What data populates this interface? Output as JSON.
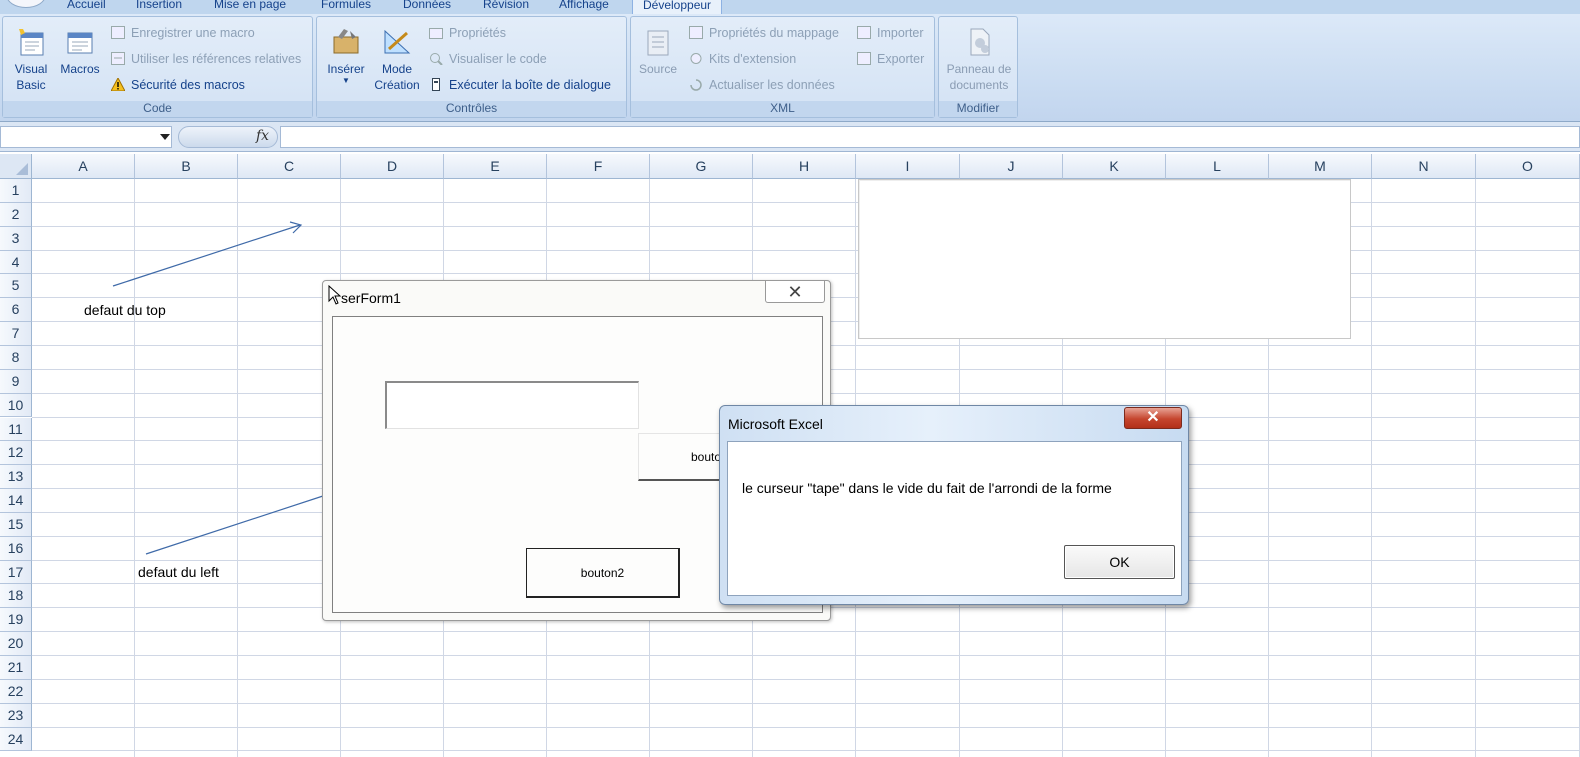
{
  "ribbon": {
    "tabs": [
      "Accueil",
      "Insertion",
      "Mise en page",
      "Formules",
      "Données",
      "Révision",
      "Affichage",
      "Développeur"
    ],
    "groups": {
      "code": {
        "label": "Code",
        "visual_basic": [
          "Visual",
          "Basic"
        ],
        "macros": "Macros",
        "record_macro": "Enregistrer une macro",
        "relative_refs": "Utiliser les références relatives",
        "macro_security": "Sécurité des macros"
      },
      "controls": {
        "label": "Contrôles",
        "insert": "Insérer",
        "design_mode": [
          "Mode",
          "Création"
        ],
        "properties": "Propriétés",
        "view_code": "Visualiser le code",
        "run_dialog": "Exécuter la boîte de dialogue"
      },
      "xml": {
        "label": "XML",
        "source": "Source",
        "map_properties": "Propriétés du mappage",
        "expansion_packs": "Kits d'extension",
        "refresh_data": "Actualiser les données",
        "import": "Importer",
        "export": "Exporter"
      },
      "modify": {
        "label": "Modifier",
        "document_panel": [
          "Panneau de",
          "documents"
        ]
      }
    }
  },
  "formula_bar": {
    "fx": "fx",
    "name_box": "",
    "formula": ""
  },
  "sheet": {
    "columns": [
      "A",
      "B",
      "C",
      "D",
      "E",
      "F",
      "G",
      "H",
      "I",
      "J",
      "K",
      "L",
      "M",
      "N",
      "O"
    ],
    "rows": [
      1,
      2,
      3,
      4,
      5,
      6,
      7,
      8,
      9,
      10,
      11,
      12,
      13,
      14,
      15,
      16,
      17,
      18,
      19,
      20,
      21,
      22,
      23,
      24
    ],
    "annotations": {
      "top_note": "defaut du top",
      "left_note": "defaut du left"
    }
  },
  "userform": {
    "title": "serForm1",
    "close_glyph": "✕",
    "bouton1_label": "bouto",
    "bouton2_label": "bouton2"
  },
  "msgbox": {
    "title": "Microsoft Excel",
    "close_glyph": "✕",
    "message": "le curseur \"tape\" dans le vide du fait de l'arrondi de la forme",
    "ok_label": "OK"
  },
  "colors": {
    "ribbon_blue": "#c9dbf1",
    "grid_line": "#d0d7e5",
    "arrow": "#3f6aa8",
    "close_red": "#c5452e"
  }
}
